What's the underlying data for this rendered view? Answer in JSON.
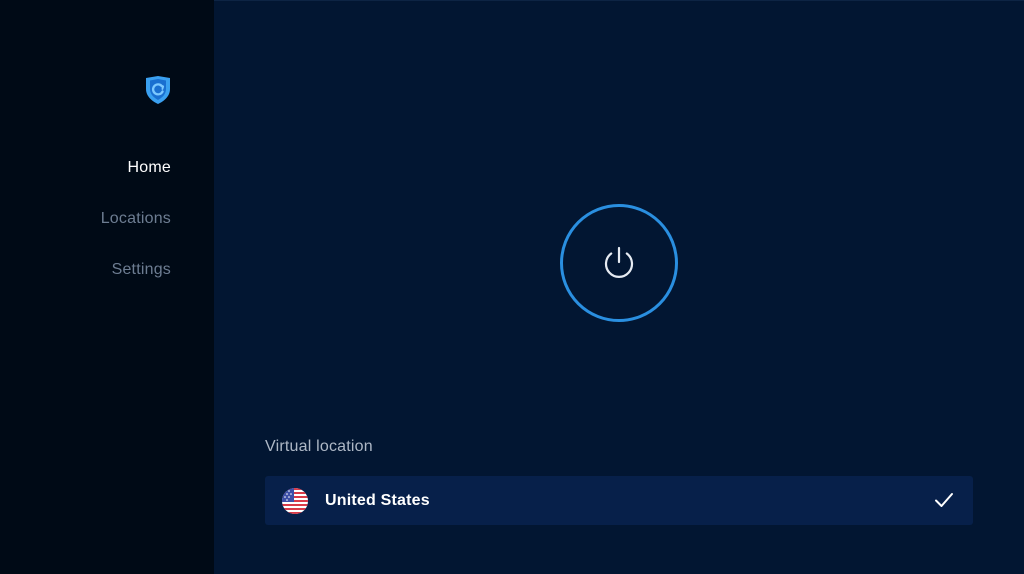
{
  "sidebar": {
    "logo_icon": "shield-logo-icon",
    "items": [
      {
        "label": "Home",
        "active": true
      },
      {
        "label": "Locations",
        "active": false
      },
      {
        "label": "Settings",
        "active": false
      }
    ]
  },
  "main": {
    "power_icon": "power-icon",
    "virtual_location": {
      "label": "Virtual location",
      "selected": {
        "name": "United States",
        "flag_icon": "us-flag-icon",
        "status_icon": "checkmark-icon"
      }
    }
  },
  "colors": {
    "sidebar_bg": "#000a16",
    "main_bg": "#021632",
    "accent": "#2a8fe0",
    "row_bg": "#07204a",
    "active_text": "#ffffff",
    "inactive_text": "#6d7d92"
  }
}
